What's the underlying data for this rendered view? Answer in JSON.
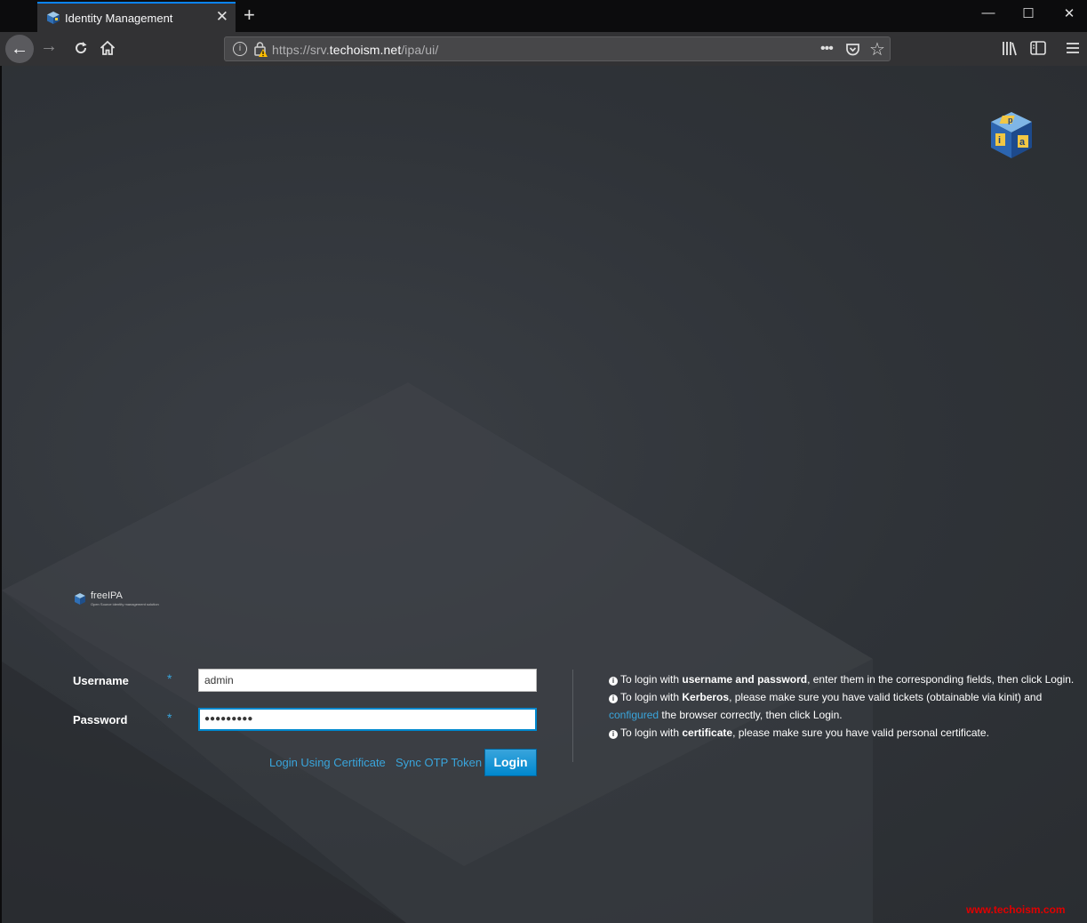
{
  "browser": {
    "tab_title": "Identity Management",
    "tab_close_glyph": "✕",
    "new_tab_glyph": "+",
    "window_controls": {
      "minimize": "—",
      "maximize": "☐",
      "close": "✕"
    },
    "url": {
      "scheme": "https://srv.",
      "host": "techoism.net",
      "path": "/ipa/ui/"
    },
    "nav_icons": [
      "back-arrow-icon",
      "forward-arrow-icon",
      "reload-icon",
      "home-icon"
    ],
    "url_actions": {
      "more": "•••",
      "pocket": "pocket-icon",
      "bookmark": "☆"
    },
    "toolbar_icons": [
      "library-icon",
      "sidebar-icon",
      "menu-icon"
    ]
  },
  "page": {
    "brand_name": "freeIPA",
    "brand_tagline": "Open Source identity management solution",
    "username": {
      "label": "Username",
      "required_mark": "*",
      "value": "admin"
    },
    "password": {
      "label": "Password",
      "required_mark": "*",
      "value": "●●●●●●●●●"
    },
    "links": {
      "cert_login": "Login Using Certificate",
      "sync_otp": "Sync OTP Token"
    },
    "login_button": "Login",
    "help": {
      "line1_pre": "To login with ",
      "line1_bold": "username and password",
      "line1_post": ", enter them in the corresponding fields, then click Login.",
      "line2_pre": "To login with ",
      "line2_bold": "Kerberos",
      "line2_mid": ", please make sure you have valid tickets (obtainable via kinit) and ",
      "line2_link": "configured",
      "line2_post": " the browser correctly, then click Login.",
      "line3_pre": "To login with ",
      "line3_bold": "certificate",
      "line3_post": ", please make sure you have valid personal certificate."
    },
    "watermark": "www.techoism.com"
  },
  "colors": {
    "accent_blue": "#0a84ff",
    "link_blue": "#39a5dc",
    "button_blue": "#0088ce",
    "watermark_red": "#e00000"
  }
}
